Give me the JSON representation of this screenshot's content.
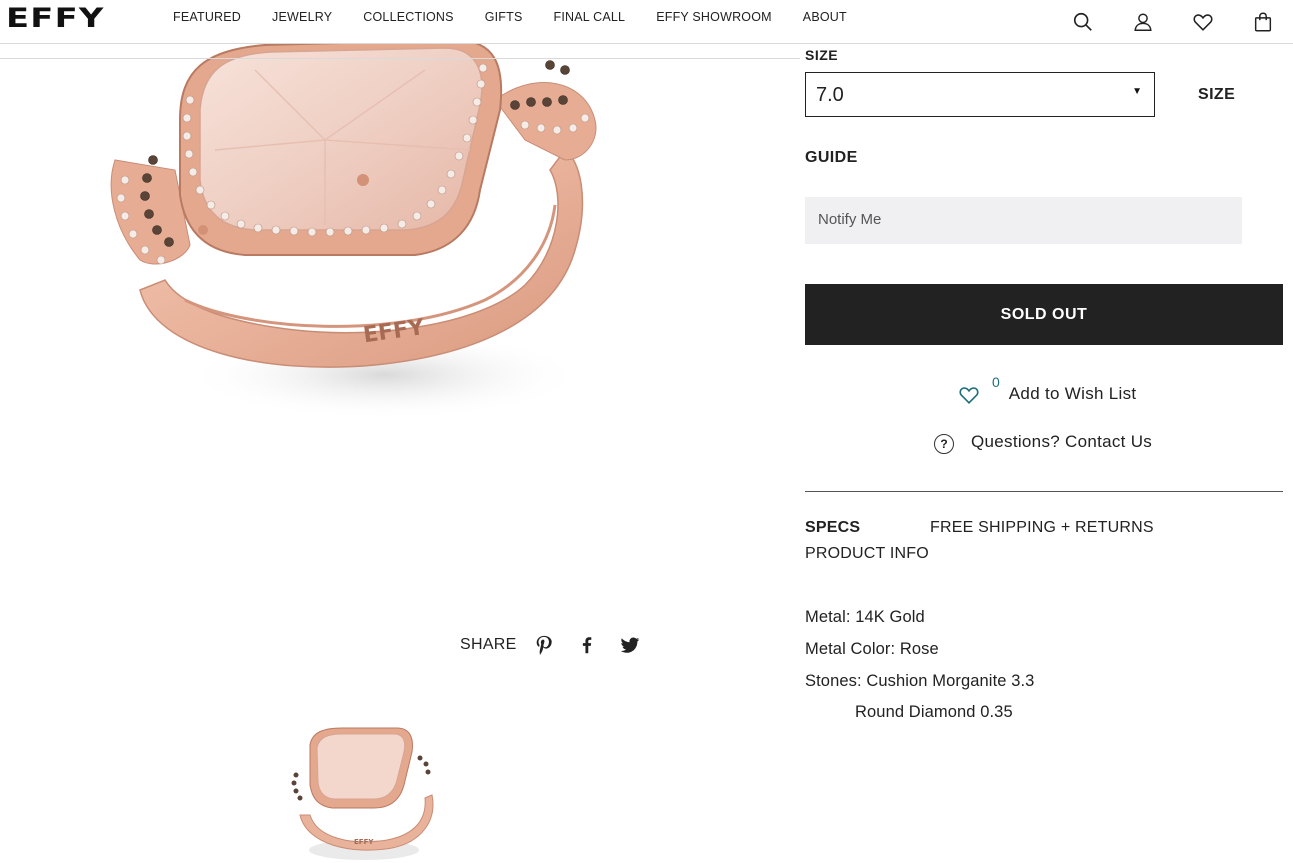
{
  "header": {
    "logo": "EFFY",
    "nav": [
      "FEATURED",
      "JEWELRY",
      "COLLECTIONS",
      "GIFTS",
      "FINAL CALL",
      "EFFY SHOWROOM",
      "ABOUT"
    ],
    "icons": [
      "search-icon",
      "account-icon",
      "wishlist-heart-icon",
      "shopping-bag-icon"
    ]
  },
  "share": {
    "label": "SHARE",
    "icons": [
      "pinterest-icon",
      "facebook-icon",
      "twitter-icon"
    ]
  },
  "product": {
    "size_label_top": "SIZE",
    "size_selected": "7.0",
    "size_guide_a": "SIZE",
    "size_guide_b": "GUIDE",
    "notify_label": "Notify Me",
    "soldout_label": "SOLD OUT",
    "wishlist_count": "0",
    "wishlist_label": "Add to Wish List",
    "questions_icon": "?",
    "questions_label": "Questions? Contact Us"
  },
  "tabs": {
    "specs": "SPECS",
    "shipping": "FREE SHIPPING + RETURNS",
    "info": "PRODUCT INFO"
  },
  "specs": [
    "Metal: 14K Gold",
    "Metal Color: Rose",
    "Stones: Cushion Morganite 3.3",
    "Round Diamond 0.35"
  ],
  "colors": {
    "accent_dark": "#222222",
    "notify_bg": "#f0f0f2",
    "wish_count": "#1f6f7a",
    "rose_gold": "#e8b39c"
  }
}
